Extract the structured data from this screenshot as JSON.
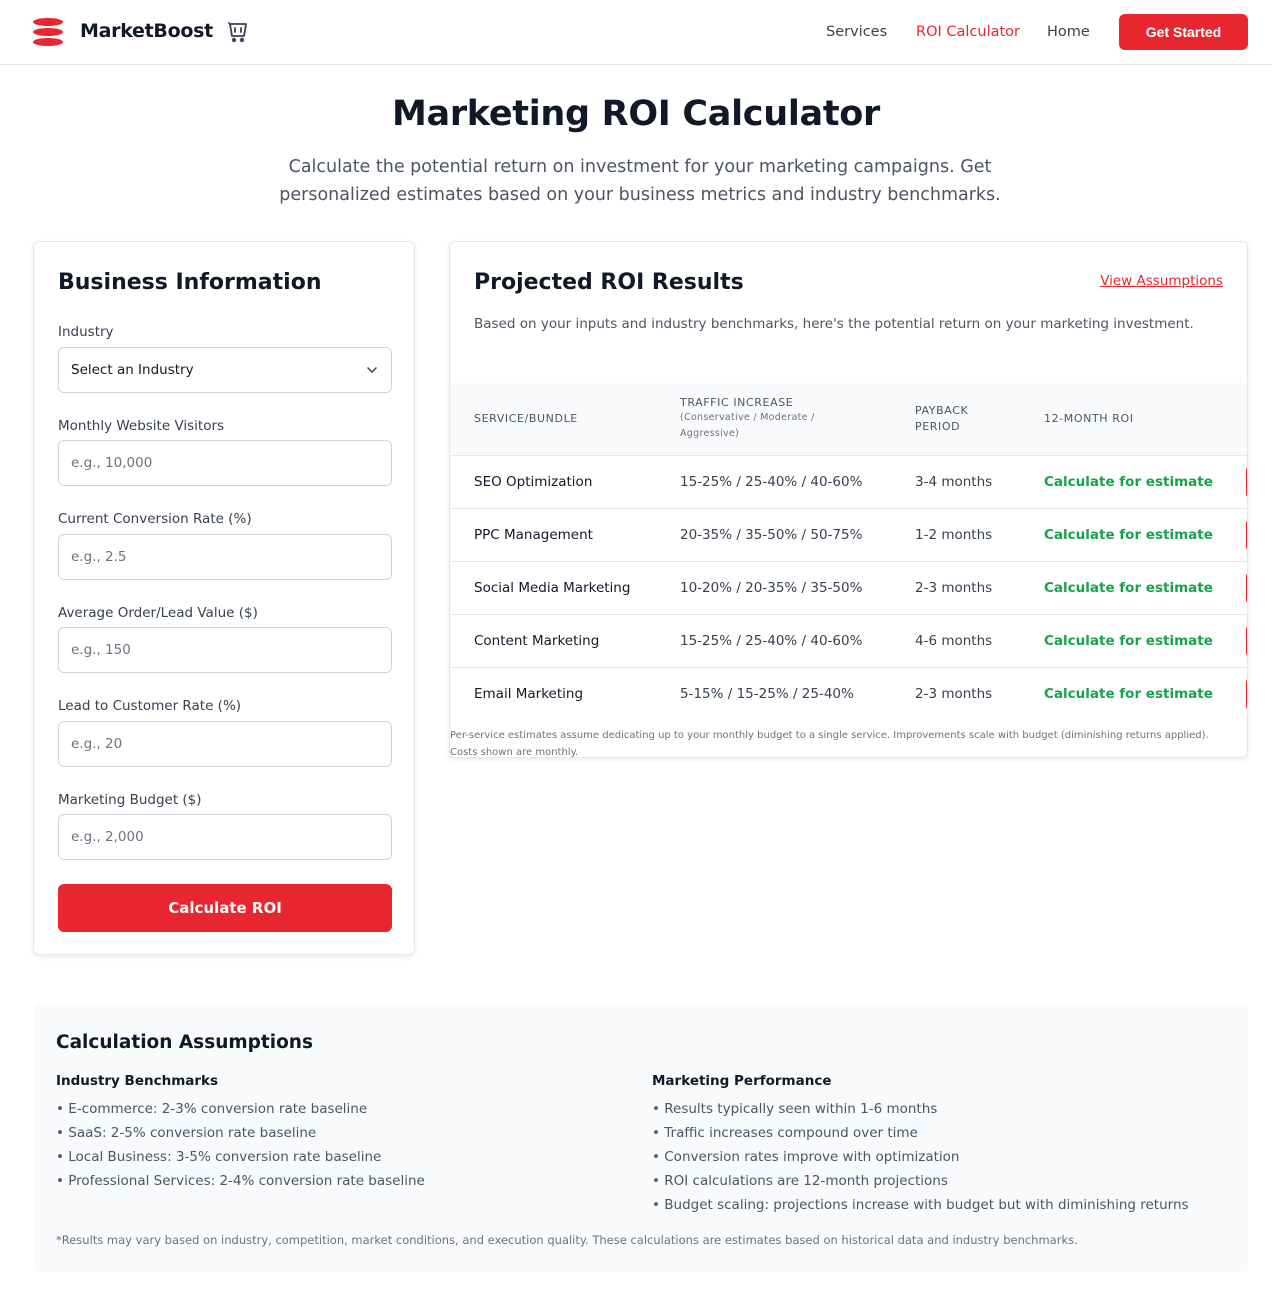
{
  "header": {
    "brand": "MarketBoost",
    "nav": [
      "Services",
      "ROI Calculator",
      "Home"
    ],
    "active_nav": "ROI Calculator",
    "cta": "Get Started",
    "brand_color": "#e8262f"
  },
  "hero": {
    "title": "Marketing ROI Calculator",
    "subtitle": "Calculate the potential return on investment for your marketing campaigns. Get personalized estimates based on your business metrics and industry benchmarks."
  },
  "form": {
    "title": "Business Information",
    "industry_label": "Industry",
    "industry_value": "Select an Industry",
    "visitors_label": "Monthly Website Visitors",
    "visitors_placeholder": "e.g., 10,000",
    "conversion_label": "Current Conversion Rate (%)",
    "conversion_placeholder": "e.g., 2.5",
    "order_label": "Average Order/Lead Value ($)",
    "order_placeholder": "e.g., 150",
    "lead_label": "Lead to Customer Rate (%)",
    "lead_placeholder": "e.g., 20",
    "budget_label": "Marketing Budget ($)",
    "budget_placeholder": "e.g., 2,000",
    "submit": "Calculate ROI"
  },
  "results": {
    "title": "Projected ROI Results",
    "link": "View Assumptions",
    "description": "Based on your inputs and industry benchmarks, here's the potential return on your marketing investment.",
    "columns": {
      "service": "Service/Bundle",
      "traffic": "Traffic Increase",
      "traffic_sub_1": "(Conservative / Moderate /",
      "traffic_sub_2": "Aggressive)",
      "payback_1": "Payback",
      "payback_2": "Period",
      "roi": "12-Month ROI"
    },
    "rows": [
      {
        "service": "SEO Optimization",
        "traffic": "15-25% / 25-40% / 40-60%",
        "payback": "3-4 months",
        "roi": "Calculate for estimate"
      },
      {
        "service": "PPC Management",
        "traffic": "20-35% / 35-50% / 50-75%",
        "payback": "1-2 months",
        "roi": "Calculate for estimate"
      },
      {
        "service": "Social Media Marketing",
        "traffic": "10-20% / 20-35% / 35-50%",
        "payback": "2-3 months",
        "roi": "Calculate for estimate"
      },
      {
        "service": "Content Marketing",
        "traffic": "15-25% / 25-40% / 40-60%",
        "payback": "4-6 months",
        "roi": "Calculate for estimate"
      },
      {
        "service": "Email Marketing",
        "traffic": "5-15% / 15-25% / 25-40%",
        "payback": "2-3 months",
        "roi": "Calculate for estimate"
      }
    ],
    "note": "Per-service estimates assume dedicating up to your monthly budget to a single service. Improvements scale with budget (diminishing returns applied). Costs shown are monthly."
  },
  "assumptions": {
    "title": "Calculation Assumptions",
    "benchmarks_title": "Industry Benchmarks",
    "benchmarks": [
      "• E-commerce: 2-3% conversion rate baseline",
      "• SaaS: 2-5% conversion rate baseline",
      "• Local Business: 3-5% conversion rate baseline",
      "• Professional Services: 2-4% conversion rate baseline"
    ],
    "performance_title": "Marketing Performance",
    "performance": [
      "• Results typically seen within 1-6 months",
      "• Traffic increases compound over time",
      "• Conversion rates improve with optimization",
      "• ROI calculations are 12-month projections",
      "• Budget scaling: projections increase with budget but with diminishing returns"
    ],
    "footnote": "*Results may vary based on industry, competition, market conditions, and execution quality. These calculations are estimates based on historical data and industry benchmarks."
  }
}
